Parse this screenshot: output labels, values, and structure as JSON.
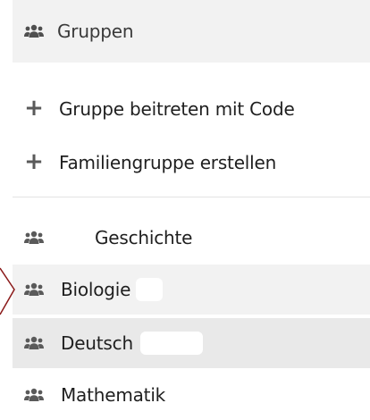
{
  "groups_panel": {
    "header": {
      "label": "Gruppen",
      "icon": "group-icon"
    },
    "actions": [
      {
        "label": "Gruppe beitreten mit Code",
        "icon": "plus-icon"
      },
      {
        "label": "Familiengruppe erstellen",
        "icon": "plus-icon"
      }
    ],
    "groups": [
      {
        "label": "Geschichte",
        "icon": "group-icon"
      },
      {
        "label": "Biologie",
        "icon": "group-icon"
      },
      {
        "label": "Deutsch",
        "icon": "group-icon"
      },
      {
        "label": "Mathematik",
        "icon": "group-icon"
      }
    ]
  },
  "colors": {
    "header_bg": "#f2f2f2",
    "row_alt_bg": "#f2f2f2",
    "row_selected_bg": "#e9e9e9",
    "icon_color": "#5a5a5a",
    "annotation_line": "#8b1a1a"
  }
}
